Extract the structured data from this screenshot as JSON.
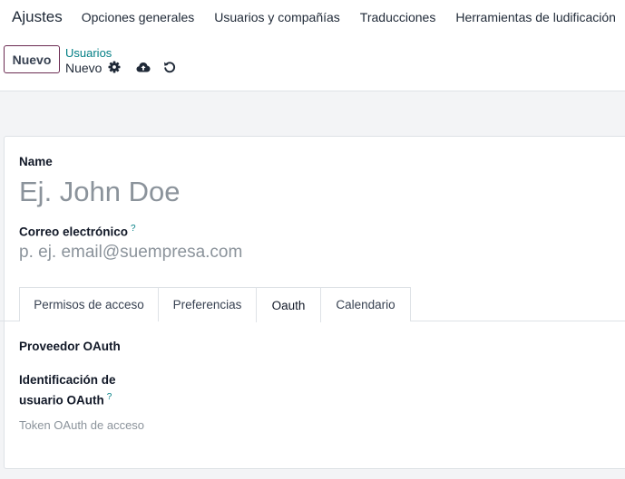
{
  "navbar": {
    "app_title": "Ajustes",
    "menu": [
      "Opciones generales",
      "Usuarios y compañías",
      "Traducciones",
      "Herramientas de ludificación"
    ]
  },
  "control_panel": {
    "new_button": "Nuevo",
    "breadcrumb_parent": "Usuarios",
    "record_name": "Nuevo",
    "icons": [
      "gear-icon",
      "cloud-upload-icon",
      "discard-icon"
    ]
  },
  "form": {
    "name_label": "Name",
    "name_placeholder": "Ej. John Doe",
    "email_label": "Correo electrónico",
    "email_help": "?",
    "email_placeholder": "p. ej. email@suempresa.com",
    "tabs": [
      "Permisos de acceso",
      "Preferencias",
      "Oauth",
      "Calendario"
    ],
    "active_tab": "Oauth",
    "oauth": {
      "provider_label": "Proveedor OAuth",
      "user_id_label_line1": "Identificación de",
      "user_id_label_line2": "usuario OAuth",
      "user_id_help": "?",
      "token_label": "Token OAuth de acceso"
    }
  },
  "colors": {
    "brand": "#714b67",
    "link": "#017e84",
    "placeholder": "#8b939b",
    "border": "#dee2e6"
  }
}
